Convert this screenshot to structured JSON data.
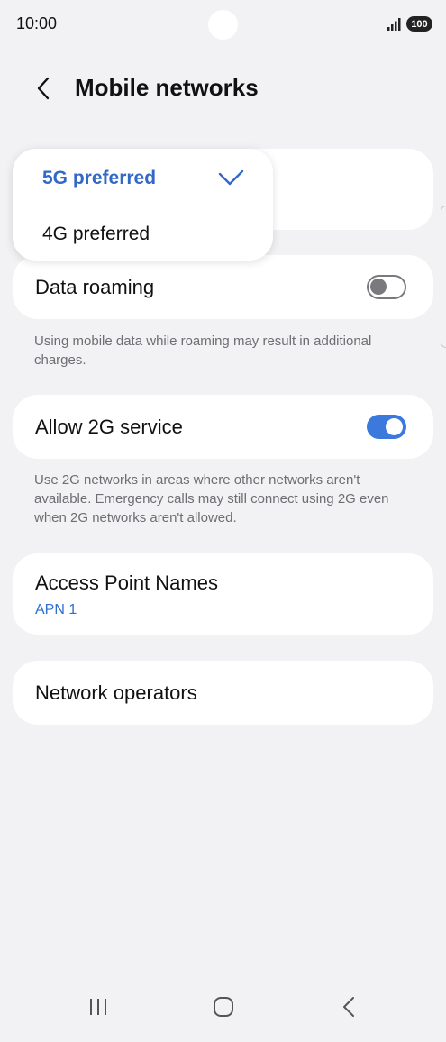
{
  "status_bar": {
    "time": "10:00",
    "battery": "100",
    "icons": [
      "signal-icon",
      "battery-icon"
    ]
  },
  "header": {
    "title": "Mobile networks",
    "back_icon": "back-chevron-icon"
  },
  "network_mode_popup": {
    "options": [
      {
        "label": "5G preferred",
        "selected": true
      },
      {
        "label": "4G preferred",
        "selected": false
      }
    ],
    "check_icon": "checkmark-icon"
  },
  "settings": {
    "data_roaming": {
      "label": "Data roaming",
      "enabled": false,
      "description": "Using mobile data while roaming may result in additional charges."
    },
    "allow_2g": {
      "label": "Allow 2G service",
      "enabled": true,
      "description": "Use 2G networks in areas where other networks aren't available. Emergency calls may still connect using 2G even when 2G networks aren't allowed."
    },
    "apn": {
      "label": "Access Point Names",
      "value": "APN 1"
    },
    "network_operators": {
      "label": "Network operators"
    }
  },
  "nav_bar": {
    "icons": [
      "recent-apps-icon",
      "home-icon",
      "back-icon"
    ]
  },
  "colors": {
    "accent": "#3b79dc",
    "selected_text": "#3269c8",
    "background": "#f2f2f4"
  }
}
